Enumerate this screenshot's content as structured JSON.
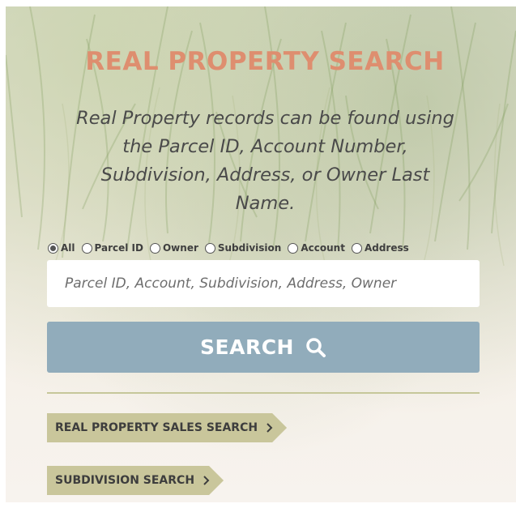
{
  "header": {
    "title": "REAL PROPERTY SEARCH",
    "subtitle": "Real Property records can be found using the Parcel ID, Account Number, Subdivision, Address, or Owner Last Name."
  },
  "filters": {
    "selected": "All",
    "options": [
      "All",
      "Parcel ID",
      "Owner",
      "Subdivision",
      "Account",
      "Address"
    ]
  },
  "search": {
    "value": "",
    "placeholder": "Parcel ID, Account, Subdivision, Address, Owner",
    "button_label": "SEARCH",
    "button_icon": "search-icon"
  },
  "links": {
    "sales_search": "REAL PROPERTY SALES SEARCH",
    "subdivision_search": "SUBDIVISION SEARCH",
    "link_icon": "chevron-right-icon"
  },
  "colors": {
    "title": "#de8e6f",
    "search_button": "#91acbb",
    "link_tag": "#c9c69b",
    "divider": "#c6c79a"
  }
}
